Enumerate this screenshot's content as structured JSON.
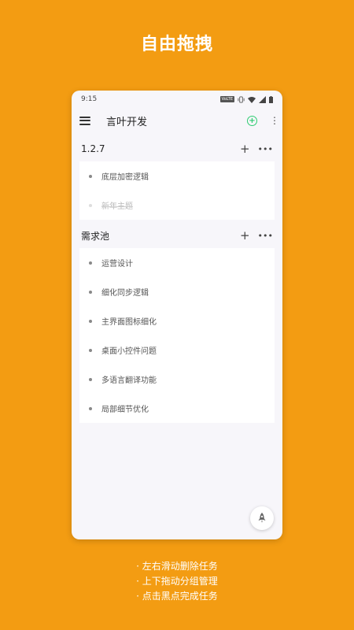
{
  "headline": "自由拖拽",
  "status": {
    "time": "9:15",
    "volte": "VoLTE"
  },
  "appbar": {
    "title": "言叶开发"
  },
  "groups": [
    {
      "title": "1.2.7",
      "items": [
        {
          "label": "底层加密逻辑",
          "done": false
        },
        {
          "label": "新年主题",
          "done": true
        }
      ]
    },
    {
      "title": "需求池",
      "items": [
        {
          "label": "运营设计",
          "done": false
        },
        {
          "label": "细化同步逻辑",
          "done": false
        },
        {
          "label": "主界面图标细化",
          "done": false
        },
        {
          "label": "桌面小控件问题",
          "done": false
        },
        {
          "label": "多语言翻译功能",
          "done": false
        },
        {
          "label": "局部细节优化",
          "done": false
        }
      ]
    }
  ],
  "captions": [
    "· 左右滑动删除任务",
    "· 上下拖动分组管理",
    "· 点击黑点完成任务"
  ],
  "colors": {
    "background": "#F39C12",
    "accent_green": "#2ECC71"
  }
}
